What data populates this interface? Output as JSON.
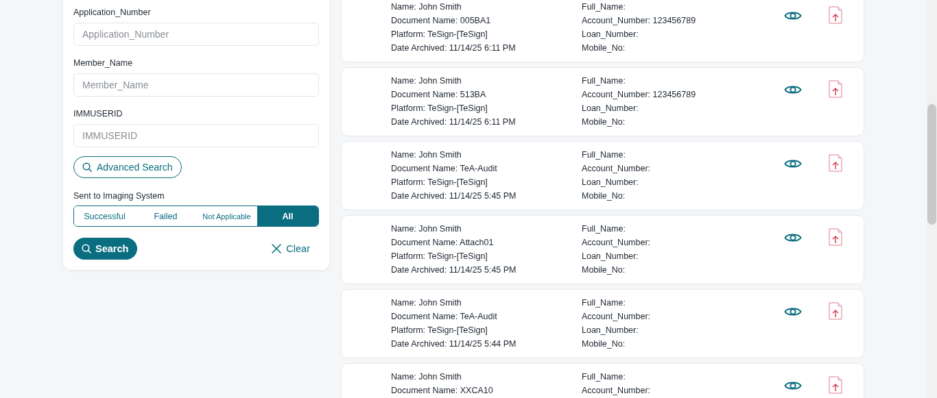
{
  "filters": {
    "fields": [
      {
        "label": "Application_Number",
        "placeholder": "Application_Number"
      },
      {
        "label": "Member_Name",
        "placeholder": "Member_Name"
      },
      {
        "label": "IMMUSERID",
        "placeholder": "IMMUSERID"
      }
    ],
    "advanced_search": "Advanced Search",
    "sent_to_imaging": {
      "label": "Sent to Imaging System",
      "options": [
        {
          "label": "Successful",
          "selected": false
        },
        {
          "label": "Failed",
          "selected": false
        },
        {
          "label": "Not Applicable",
          "selected": false
        },
        {
          "label": "All",
          "selected": true
        }
      ]
    },
    "search_button": "Search",
    "clear_button": "Clear"
  },
  "records": [
    {
      "left": [
        "Name: John Smith",
        "Document Name: 005BA1",
        "Platform: TeSign-[TeSign]",
        "Date Archived: 11/14/25 6:11 PM"
      ],
      "right": [
        "Full_Name:",
        "Account_Number: 123456789",
        "Loan_Number:",
        "Mobile_No:"
      ]
    },
    {
      "left": [
        "Name: John Smith",
        "Document Name: 513BA",
        "Platform: TeSign-[TeSign]",
        "Date Archived: 11/14/25 6:11 PM"
      ],
      "right": [
        "Full_Name:",
        "Account_Number: 123456789",
        "Loan_Number:",
        "Mobile_No:"
      ]
    },
    {
      "left": [
        "Name: John Smith",
        "Document Name: TeA-Audit",
        "Platform: TeSign-[TeSign]",
        "Date Archived: 11/14/25 5:45 PM"
      ],
      "right": [
        "Full_Name:",
        "Account_Number:",
        "Loan_Number:",
        "Mobile_No:"
      ]
    },
    {
      "left": [
        "Name: John Smith",
        "Document Name: Attach01",
        "Platform: TeSign-[TeSign]",
        "Date Archived: 11/14/25 5:45 PM"
      ],
      "right": [
        "Full_Name:",
        "Account_Number:",
        "Loan_Number:",
        "Mobile_No:"
      ]
    },
    {
      "left": [
        "Name: John Smith",
        "Document Name: TeA-Audit",
        "Platform: TeSign-[TeSign]",
        "Date Archived: 11/14/25 5:44 PM"
      ],
      "right": [
        "Full_Name:",
        "Account_Number:",
        "Loan_Number:",
        "Mobile_No:"
      ]
    },
    {
      "left": [
        "Name: John Smith",
        "Document Name: XXCA10"
      ],
      "right": [
        "Full_Name:",
        "Account_Number:"
      ]
    }
  ]
}
